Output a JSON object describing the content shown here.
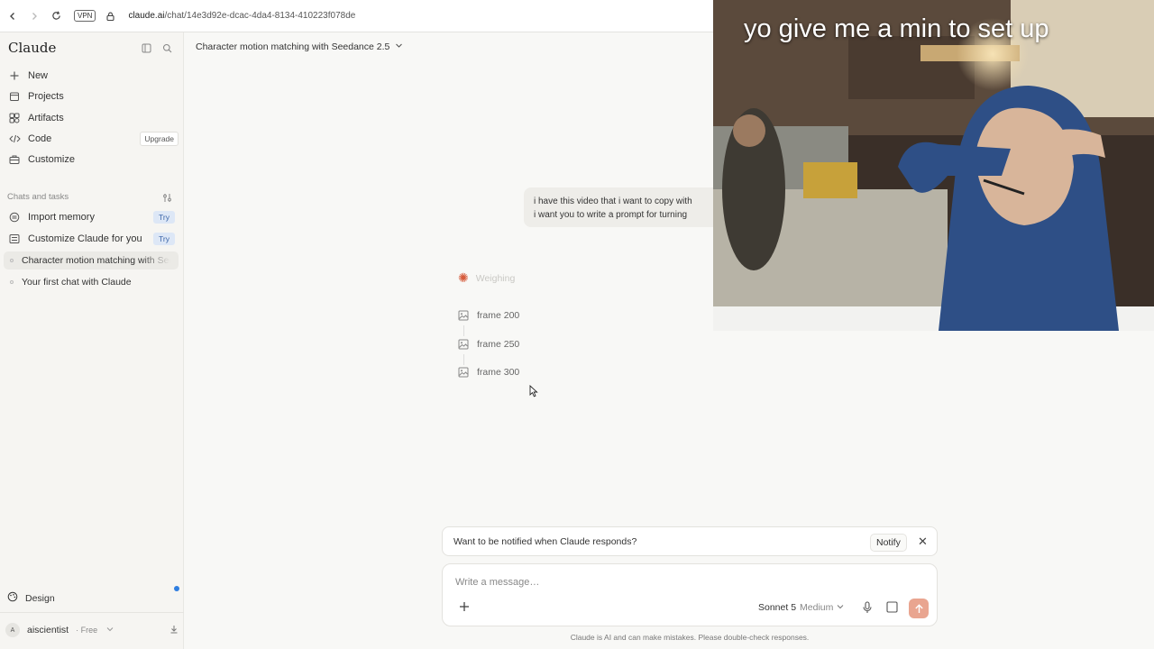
{
  "browser": {
    "vpn_label": "VPN",
    "url_domain": "claude.ai",
    "url_path": "/chat/14e3d92e-dcac-4da4-8134-410223f078de"
  },
  "sidebar": {
    "brand": "Claude",
    "items": [
      {
        "label": "New",
        "icon": "plus-icon"
      },
      {
        "label": "Projects",
        "icon": "folder-icon"
      },
      {
        "label": "Artifacts",
        "icon": "artifacts-icon"
      },
      {
        "label": "Code",
        "icon": "code-icon",
        "badge": "Upgrade"
      },
      {
        "label": "Customize",
        "icon": "briefcase-icon"
      }
    ],
    "section_label": "Chats and tasks",
    "chats": [
      {
        "label": "Import memory",
        "badge": "Try",
        "icon": "import-icon"
      },
      {
        "label": "Customize Claude for you",
        "badge": "Try",
        "icon": "sliders-icon"
      },
      {
        "label": "Character motion matching with Seedance 2.5",
        "active": true
      },
      {
        "label": "Your first chat with Claude"
      }
    ],
    "design_label": "Design",
    "user": {
      "initial": "A",
      "name": "aiscientist",
      "plan": "· Free"
    }
  },
  "main": {
    "chat_title": "Character motion matching with Seedance 2.5",
    "user_message_lines": [
      "i have this video that i want to copy with",
      "i want you to write a prompt for turning"
    ],
    "status": "Weighing",
    "frames": [
      "frame 200",
      "frame 250",
      "frame 300"
    ]
  },
  "notify": {
    "text": "Want to be notified when Claude responds?",
    "button": "Notify"
  },
  "composer": {
    "placeholder": "Write a message…",
    "model": "Sonnet 5",
    "effort": "Medium",
    "disclaimer": "Claude is AI and can make mistakes. Please double-check responses."
  },
  "webcam": {
    "caption": "yo give me a min to set up"
  },
  "colors": {
    "accent": "#d65b3c",
    "send_button": "#e9a590",
    "try_badge_bg": "#dde7f6"
  }
}
